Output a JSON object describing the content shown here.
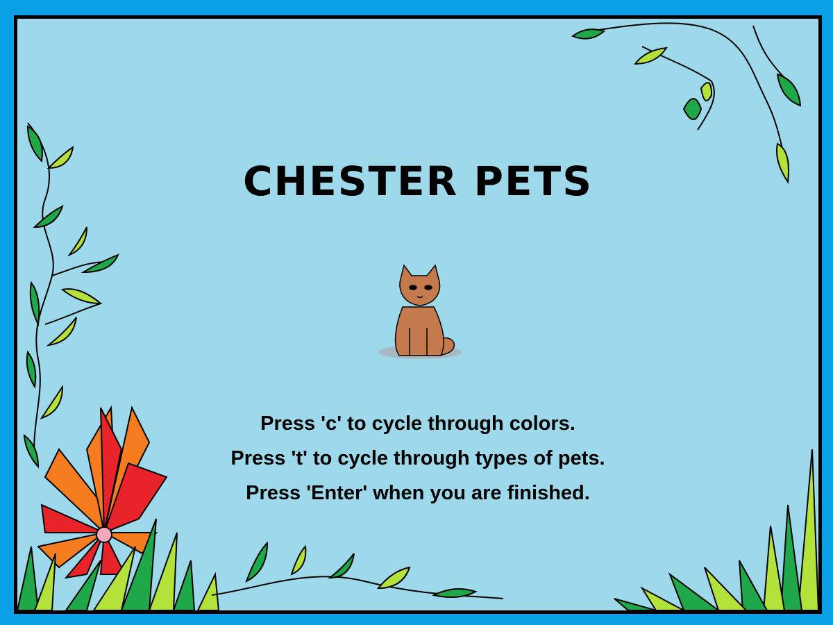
{
  "screen": {
    "title": "CHESTER PETS",
    "instructions": [
      "Press 'c' to cycle through colors.",
      "Press 't' to cycle through types of pets.",
      "Press 'Enter' when you are finished."
    ],
    "current_pet": "cat",
    "current_pet_color": "#c47a4c"
  },
  "colors": {
    "frame": "#0aa0e6",
    "background": "#9dd9ea",
    "border": "#000000",
    "leaf_dark": "#1fa84a",
    "leaf_light": "#b3e23a",
    "flower_red": "#e8232a",
    "flower_orange": "#f57d20",
    "flower_center": "#f4a9bb"
  }
}
